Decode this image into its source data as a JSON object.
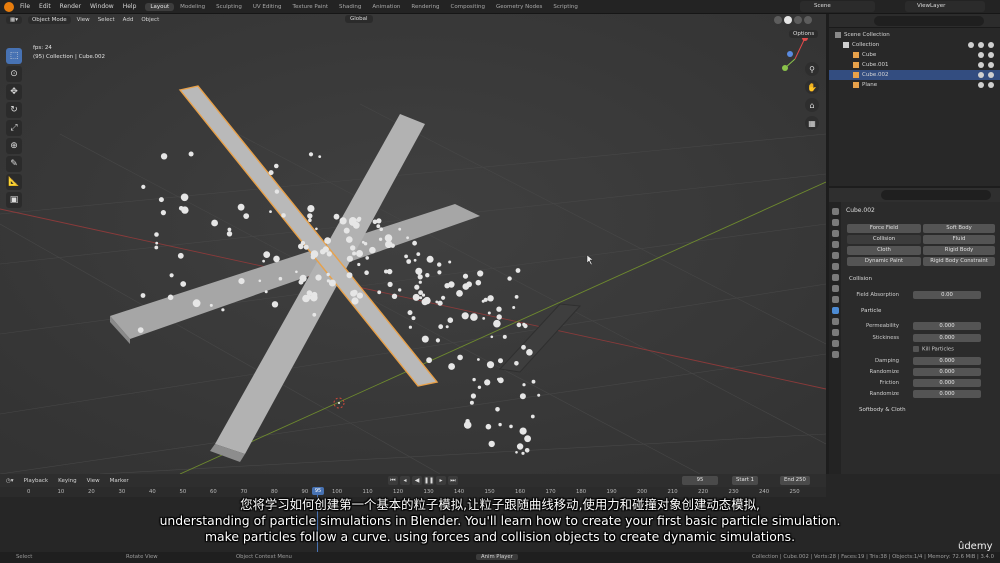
{
  "topbar": {
    "menus": [
      "File",
      "Edit",
      "Render",
      "Window",
      "Help"
    ],
    "workspaces": [
      "Layout",
      "Modeling",
      "Sculpting",
      "UV Editing",
      "Texture Paint",
      "Shading",
      "Animation",
      "Rendering",
      "Compositing",
      "Geometry Nodes",
      "Scripting"
    ],
    "active_workspace": "Layout",
    "scene": "Scene",
    "view_layer": "ViewLayer"
  },
  "viewport": {
    "mode": "Object Mode",
    "menus": [
      "View",
      "Select",
      "Add",
      "Object"
    ],
    "transform_orientation": "Global",
    "options_label": "Options",
    "hud_fps": "fps: 24",
    "hud_info": "(95) Collection | Cube.002"
  },
  "outliner": {
    "scene_collection": "Scene Collection",
    "collection": "Collection",
    "objects": [
      "Cube",
      "Cube.001",
      "Cube.002",
      "Plane"
    ],
    "selected": "Cube.002"
  },
  "properties": {
    "object_name": "Cube.002",
    "physics_buttons": [
      [
        "Force Field",
        "Soft Body"
      ],
      [
        "Collision",
        "Fluid"
      ],
      [
        "Cloth",
        "Rigid Body"
      ],
      [
        "Dynamic Paint",
        "Rigid Body Constraint"
      ]
    ],
    "collision_header": "Collision",
    "field_absorption_label": "Field Absorption",
    "field_absorption_value": "0.00",
    "particle_header": "Particle",
    "permeability_label": "Permeability",
    "permeability_value": "0.000",
    "stickiness_label": "Stickiness",
    "stickiness_value": "0.000",
    "kill_particles_label": "Kill Particles",
    "damping_label": "Damping",
    "damping_value": "0.000",
    "randomize1_label": "Randomize",
    "randomize1_value": "0.000",
    "friction_label": "Friction",
    "friction_value": "0.000",
    "randomize2_label": "Randomize",
    "randomize2_value": "0.000",
    "softbody_cloth_header": "Softbody & Cloth"
  },
  "timeline": {
    "menus": [
      "Playback",
      "Keying",
      "View",
      "Marker"
    ],
    "current_frame": "95",
    "start_label": "Start",
    "start_value": "1",
    "end_label": "End",
    "end_value": "250",
    "ticks": [
      "0",
      "10",
      "20",
      "30",
      "40",
      "50",
      "60",
      "70",
      "80",
      "90",
      "100",
      "110",
      "120",
      "130",
      "140",
      "150",
      "160",
      "170",
      "180",
      "190",
      "200",
      "210",
      "220",
      "230",
      "240",
      "250"
    ],
    "cursor_frame": "95"
  },
  "statusbar": {
    "select": "Select",
    "rotate": "Rotate View",
    "context_menu": "Object Context Menu",
    "anim_player": "Anim Player",
    "stats": "Collection | Cube.002 | Verts:28 | Faces:19 | Tris:38 | Objects:1/4 | Memory: 72.6 MiB | 3.4.0"
  },
  "subtitles": {
    "line1": "您将学习如何创建第一个基本的粒子模拟,让粒子跟随曲线移动,使用力和碰撞对象创建动态模拟,",
    "line2": "understanding of particle simulations in Blender. You'll learn how to create your first basic particle simulation.",
    "line3": "make particles follow a curve. using forces and collision objects to create dynamic simulations."
  },
  "watermark": "ûdemy",
  "colors": {
    "accent_blue": "#4772b3",
    "selection_orange": "#e8a14a",
    "viewport_bg": "#3a3a3a"
  }
}
